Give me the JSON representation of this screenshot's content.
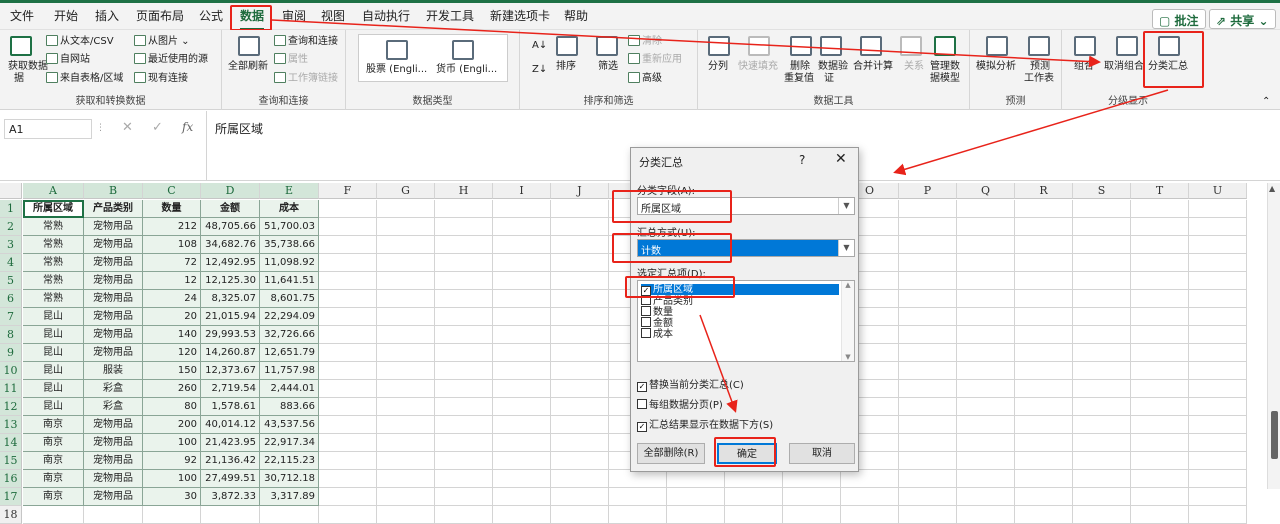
{
  "menu": {
    "items": [
      "文件",
      "开始",
      "插入",
      "页面布局",
      "公式",
      "数据",
      "审阅",
      "视图",
      "自动执行",
      "开发工具",
      "新建选项卡",
      "帮助"
    ],
    "comment_label": "批注",
    "share_label": "共享"
  },
  "ribbon": {
    "get_data": {
      "label": "获取数据",
      "label2": "据"
    },
    "from_text_csv": "从文本/CSV",
    "from_web": "自网站",
    "from_table": "来自表格/区域",
    "from_picture": "从图片",
    "recent_sources": "最近使用的源",
    "existing_connections": "现有连接",
    "group_get_transform": "获取和转换数据",
    "refresh_all": "全部刷新",
    "queries_connections": "查询和连接",
    "properties": "属性",
    "workbook_links": "工作簿链接",
    "group_queries": "查询和连接",
    "stocks": "股票 (Engli...",
    "currencies": "货币 (Engli...",
    "group_data_types": "数据类型",
    "sort": "排序",
    "filter": "筛选",
    "clear": "清除",
    "reapply": "重新应用",
    "advanced": "高级",
    "group_sort_filter": "排序和筛选",
    "text_to_columns": "分列",
    "flash_fill": "快速填充",
    "remove_duplicates_1": "删除",
    "remove_duplicates_2": "重复值",
    "data_validation_1": "数据验",
    "data_validation_2": "证",
    "consolidate": "合并计算",
    "relationships": "关系",
    "data_model_1": "管理数",
    "data_model_2": "据模型",
    "group_data_tools": "数据工具",
    "what_if": "模拟分析",
    "forecast_sheet_1": "预测",
    "forecast_sheet_2": "工作表",
    "group_forecast": "预测",
    "group_btn": "组合",
    "ungroup": "取消组合",
    "subtotal": "分类汇总",
    "group_outline": "分级显示"
  },
  "formula_bar": {
    "name_box": "A1",
    "fx": "fx",
    "content": "所属区域"
  },
  "columns": [
    "A",
    "B",
    "C",
    "D",
    "E",
    "F",
    "G",
    "H",
    "I",
    "J",
    "K",
    "L",
    "M",
    "N",
    "O",
    "P",
    "Q",
    "R",
    "S",
    "T",
    "U"
  ],
  "rows": [
    "1",
    "2",
    "3",
    "4",
    "5",
    "6",
    "7",
    "8",
    "9",
    "10",
    "11",
    "12",
    "13",
    "14",
    "15",
    "16",
    "17",
    "18"
  ],
  "table": {
    "headers": [
      "所属区域",
      "产品类别",
      "数量",
      "金额",
      "成本"
    ],
    "rows": [
      [
        "常熟",
        "宠物用品",
        "212",
        "48,705.66",
        "51,700.03"
      ],
      [
        "常熟",
        "宠物用品",
        "108",
        "34,682.76",
        "35,738.66"
      ],
      [
        "常熟",
        "宠物用品",
        "72",
        "12,492.95",
        "11,098.92"
      ],
      [
        "常熟",
        "宠物用品",
        "12",
        "12,125.30",
        "11,641.51"
      ],
      [
        "常熟",
        "宠物用品",
        "24",
        "8,325.07",
        "8,601.75"
      ],
      [
        "昆山",
        "宠物用品",
        "20",
        "21,015.94",
        "22,294.09"
      ],
      [
        "昆山",
        "宠物用品",
        "140",
        "29,993.53",
        "32,726.66"
      ],
      [
        "昆山",
        "宠物用品",
        "120",
        "14,260.87",
        "12,651.79"
      ],
      [
        "昆山",
        "服装",
        "150",
        "12,373.67",
        "11,757.98"
      ],
      [
        "昆山",
        "彩盒",
        "260",
        "2,719.54",
        "2,444.01"
      ],
      [
        "昆山",
        "彩盒",
        "80",
        "1,578.61",
        "883.66"
      ],
      [
        "南京",
        "宠物用品",
        "200",
        "40,014.12",
        "43,537.56"
      ],
      [
        "南京",
        "宠物用品",
        "100",
        "21,423.95",
        "22,917.34"
      ],
      [
        "南京",
        "宠物用品",
        "92",
        "21,136.42",
        "22,115.23"
      ],
      [
        "南京",
        "宠物用品",
        "100",
        "27,499.51",
        "30,712.18"
      ],
      [
        "南京",
        "宠物用品",
        "30",
        "3,872.33",
        "3,317.89"
      ]
    ]
  },
  "dialog": {
    "title": "分类汇总",
    "help": "?",
    "close": "✕",
    "field_label": "分类字段(A):",
    "field_value": "所属区域",
    "function_label": "汇总方式(U):",
    "function_value": "计数",
    "items_label": "选定汇总项(D):",
    "items": [
      {
        "label": "所属区域",
        "checked": true
      },
      {
        "label": "产品类别",
        "checked": false
      },
      {
        "label": "数量",
        "checked": false
      },
      {
        "label": "金额",
        "checked": false
      },
      {
        "label": "成本",
        "checked": false
      }
    ],
    "replace_current": "替换当前分类汇总(C)",
    "page_break": "每组数据分页(P)",
    "summary_below": "汇总结果显示在数据下方(S)",
    "remove_all": "全部删除(R)",
    "ok": "确定",
    "cancel": "取消"
  }
}
